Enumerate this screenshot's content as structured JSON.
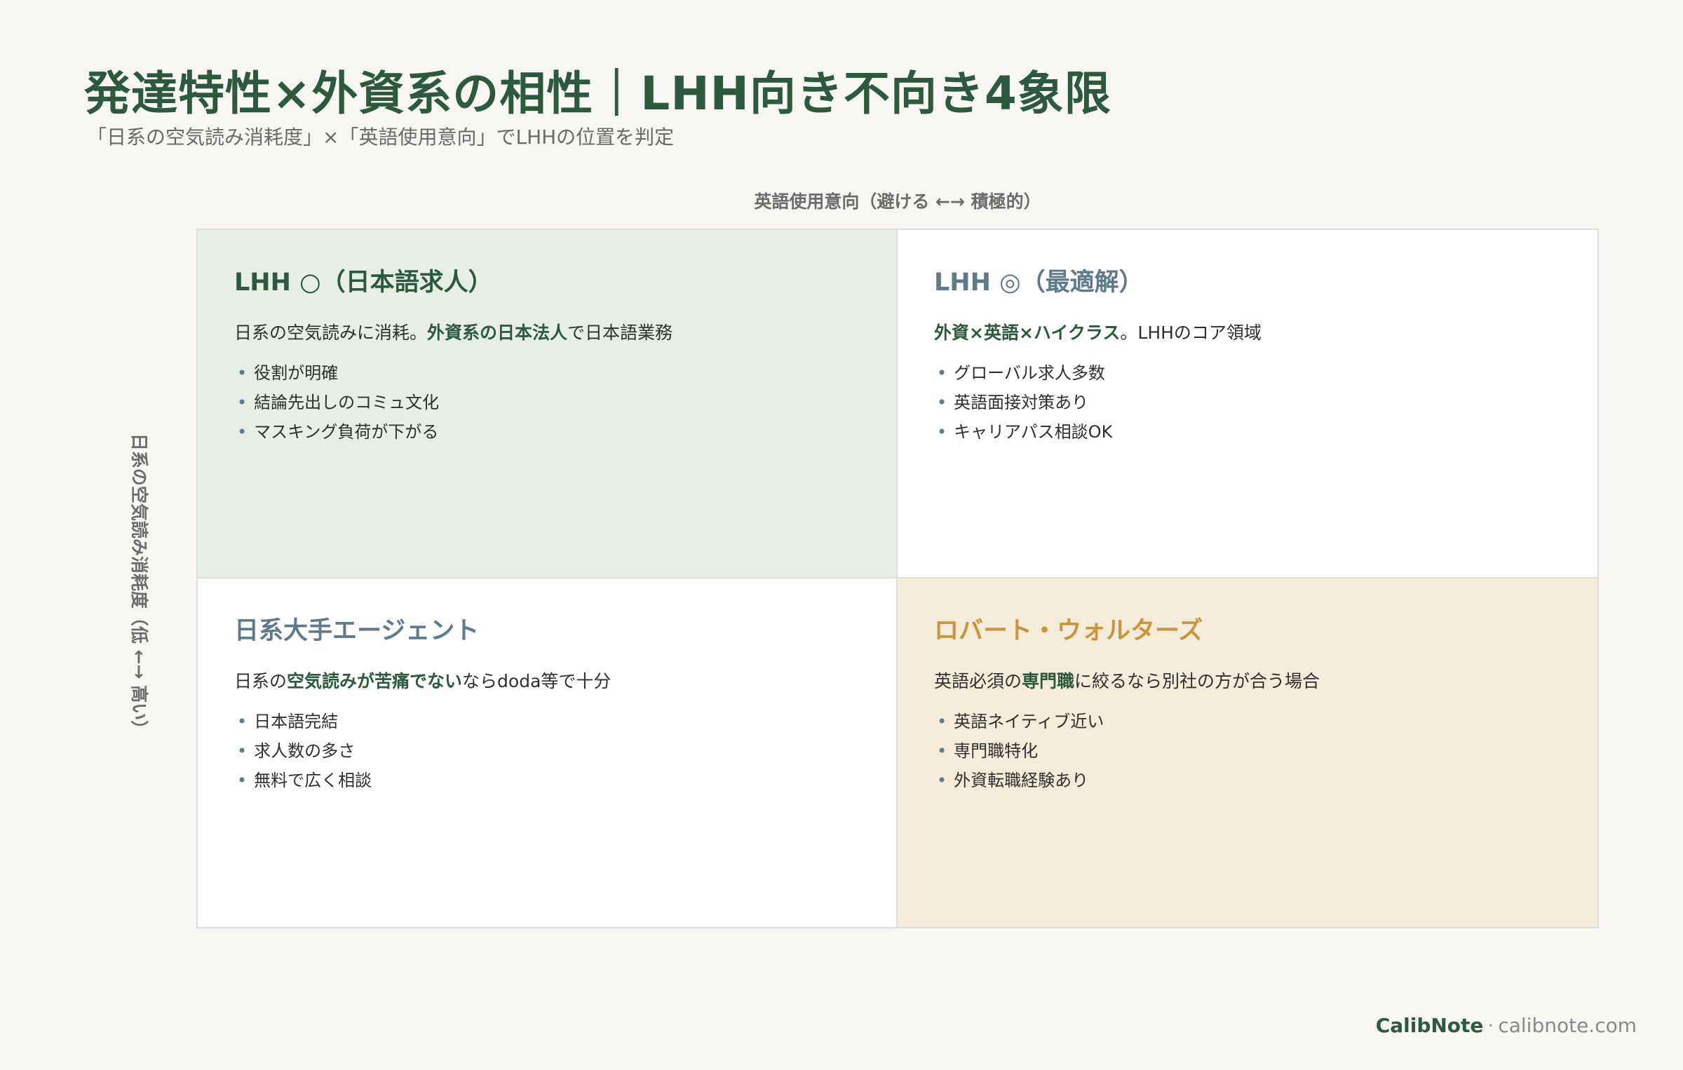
{
  "title": "発達特性×外資系の相性｜LHH向き不向き4象限",
  "subtitle": "「日系の空気読み消耗度」×「英語使用意向」でLHHの位置を判定",
  "axis_x_label": "英語使用意向（避ける ←→ 積極的）",
  "axis_y_label": "日系の空気読み消耗度（低 ←→ 高い）",
  "colors": {
    "green": "#2d5a3c",
    "slate": "#5f7a8a",
    "gold": "#c9963f",
    "mint_bg": "#e7eee6",
    "cream_bg": "#f4ebd9"
  },
  "quadrants": {
    "top_left": {
      "title": "LHH ○（日本語求人）",
      "desc_pre": "日系の空気読みに消耗。",
      "desc_hl": "外資系の日本法人",
      "desc_post": "で日本語業務",
      "bullets": [
        "役割が明確",
        "結論先出しのコミュ文化",
        "マスキング負荷が下がる"
      ]
    },
    "top_right": {
      "title": "LHH ◎（最適解）",
      "desc_pre": "",
      "desc_hl": "外資×英語×ハイクラス",
      "desc_post": "。LHHのコア領域",
      "bullets": [
        "グローバル求人多数",
        "英語面接対策あり",
        "キャリアパス相談OK"
      ]
    },
    "bottom_left": {
      "title": "日系大手エージェント",
      "desc_pre": "日系の",
      "desc_hl": "空気読みが苦痛でない",
      "desc_post": "ならdoda等で十分",
      "bullets": [
        "日本語完結",
        "求人数の多さ",
        "無料で広く相談"
      ]
    },
    "bottom_right": {
      "title": "ロバート・ウォルターズ",
      "desc_pre": "英語必須の",
      "desc_hl": "専門職",
      "desc_post": "に絞るなら別社の方が合う場合",
      "bullets": [
        "英語ネイティブ近い",
        "専門職特化",
        "外資転職経験あり"
      ]
    }
  },
  "footer": {
    "brand": "CalibNote",
    "separator": "·",
    "site": "calibnote.com"
  }
}
